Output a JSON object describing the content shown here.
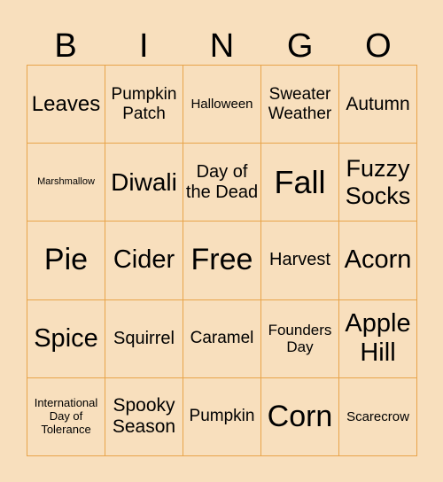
{
  "header": [
    "B",
    "I",
    "N",
    "G",
    "O"
  ],
  "cells": [
    {
      "text": "Leaves",
      "size": 24
    },
    {
      "text": "Pumpkin Patch",
      "size": 19
    },
    {
      "text": "Halloween",
      "size": 15
    },
    {
      "text": "Sweater Weather",
      "size": 19
    },
    {
      "text": "Autumn",
      "size": 21
    },
    {
      "text": "Marshmallow",
      "size": 11
    },
    {
      "text": "Diwali",
      "size": 28
    },
    {
      "text": "Day of the Dead",
      "size": 20
    },
    {
      "text": "Fall",
      "size": 36
    },
    {
      "text": "Fuzzy Socks",
      "size": 27
    },
    {
      "text": "Pie",
      "size": 34
    },
    {
      "text": "Cider",
      "size": 29
    },
    {
      "text": "Free",
      "size": 34
    },
    {
      "text": "Harvest",
      "size": 20
    },
    {
      "text": "Acorn",
      "size": 29
    },
    {
      "text": "Spice",
      "size": 29
    },
    {
      "text": "Squirrel",
      "size": 20
    },
    {
      "text": "Caramel",
      "size": 19
    },
    {
      "text": "Founders Day",
      "size": 17
    },
    {
      "text": "Apple Hill",
      "size": 29
    },
    {
      "text": "International Day of Tolerance",
      "size": 13
    },
    {
      "text": "Spooky Season",
      "size": 21
    },
    {
      "text": "Pumpkin",
      "size": 19
    },
    {
      "text": "Corn",
      "size": 34
    },
    {
      "text": "Scarecrow",
      "size": 15
    }
  ],
  "colors": {
    "background": "#f8dfbd",
    "border": "#e8a44a"
  }
}
